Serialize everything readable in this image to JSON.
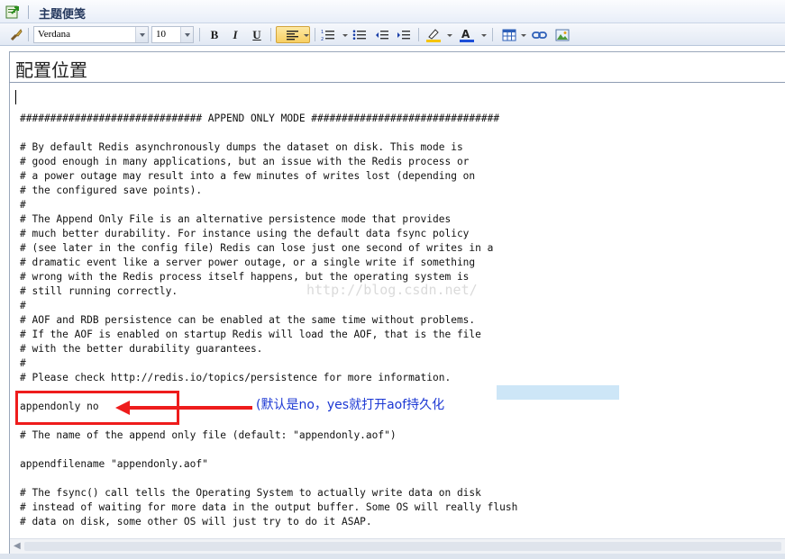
{
  "titlebar": {
    "title": "主题便笺",
    "icon": "note-export-icon"
  },
  "toolbar": {
    "font_name": "Verdana",
    "font_size": "10",
    "bold_label": "B",
    "italic_label": "I",
    "underline_label": "U",
    "buttons": [
      "brush-icon",
      "bold-icon",
      "italic-icon",
      "underline-icon",
      "align-left-icon",
      "numbered-list-icon",
      "bullet-list-icon",
      "outdent-icon",
      "indent-icon",
      "highlight-icon",
      "font-color-icon",
      "table-icon",
      "link-icon",
      "image-icon"
    ],
    "highlight_color": "#f5c400",
    "font_color": "#1d4fd8"
  },
  "note": {
    "title": "配置位置"
  },
  "code_lines": [
    "############################## APPEND ONLY MODE ###############################",
    "",
    "# By default Redis asynchronously dumps the dataset on disk. This mode is",
    "# good enough in many applications, but an issue with the Redis process or",
    "# a power outage may result into a few minutes of writes lost (depending on",
    "# the configured save points).",
    "#",
    "# The Append Only File is an alternative persistence mode that provides",
    "# much better durability. For instance using the default data fsync policy",
    "# (see later in the config file) Redis can lose just one second of writes in a",
    "# dramatic event like a server power outage, or a single write if something",
    "# wrong with the Redis process itself happens, but the operating system is",
    "# still running correctly.",
    "#",
    "# AOF and RDB persistence can be enabled at the same time without problems.",
    "# If the AOF is enabled on startup Redis will load the AOF, that is the file",
    "# with the better durability guarantees.",
    "#",
    "# Please check http://redis.io/topics/persistence for more information.",
    "",
    "appendonly no",
    "",
    "# The name of the append only file (default: \"appendonly.aof\")",
    "",
    "appendfilename \"appendonly.aof\"",
    "",
    "# The fsync() call tells the Operating System to actually write data on disk",
    "# instead of waiting for more data in the output buffer. Some OS will really flush",
    "# data on disk, some other OS will just try to do it ASAP."
  ],
  "annotation": {
    "text": "(默认是no，yes就打开aof持久化",
    "color": "#1b37d3",
    "box_color": "#ee1c1c"
  },
  "watermark": "http://blog.csdn.net/"
}
